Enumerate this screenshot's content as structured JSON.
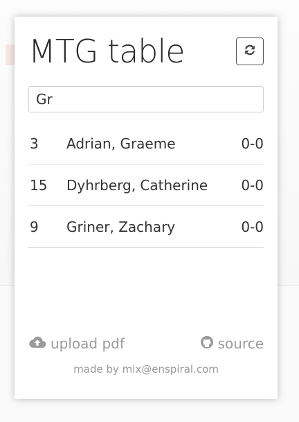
{
  "app": {
    "title": "MTG table",
    "refresh_icon": "refresh-icon"
  },
  "search": {
    "value": "Gr",
    "placeholder": ""
  },
  "players": [
    {
      "seat": "3",
      "name": "Adrian, Graeme",
      "record": "0-0"
    },
    {
      "seat": "15",
      "name": "Dyhrberg, Catherine",
      "record": "0-0"
    },
    {
      "seat": "9",
      "name": "Griner, Zachary",
      "record": "0-0"
    }
  ],
  "footer": {
    "upload_label": "upload pdf",
    "upload_icon": "cloud-upload-icon",
    "source_label": "source",
    "source_icon": "github-icon",
    "credit": "made by mix@enspiral.com"
  },
  "colors": {
    "text": "#333333",
    "muted": "#9a9a9a",
    "divider": "#dddddd"
  }
}
